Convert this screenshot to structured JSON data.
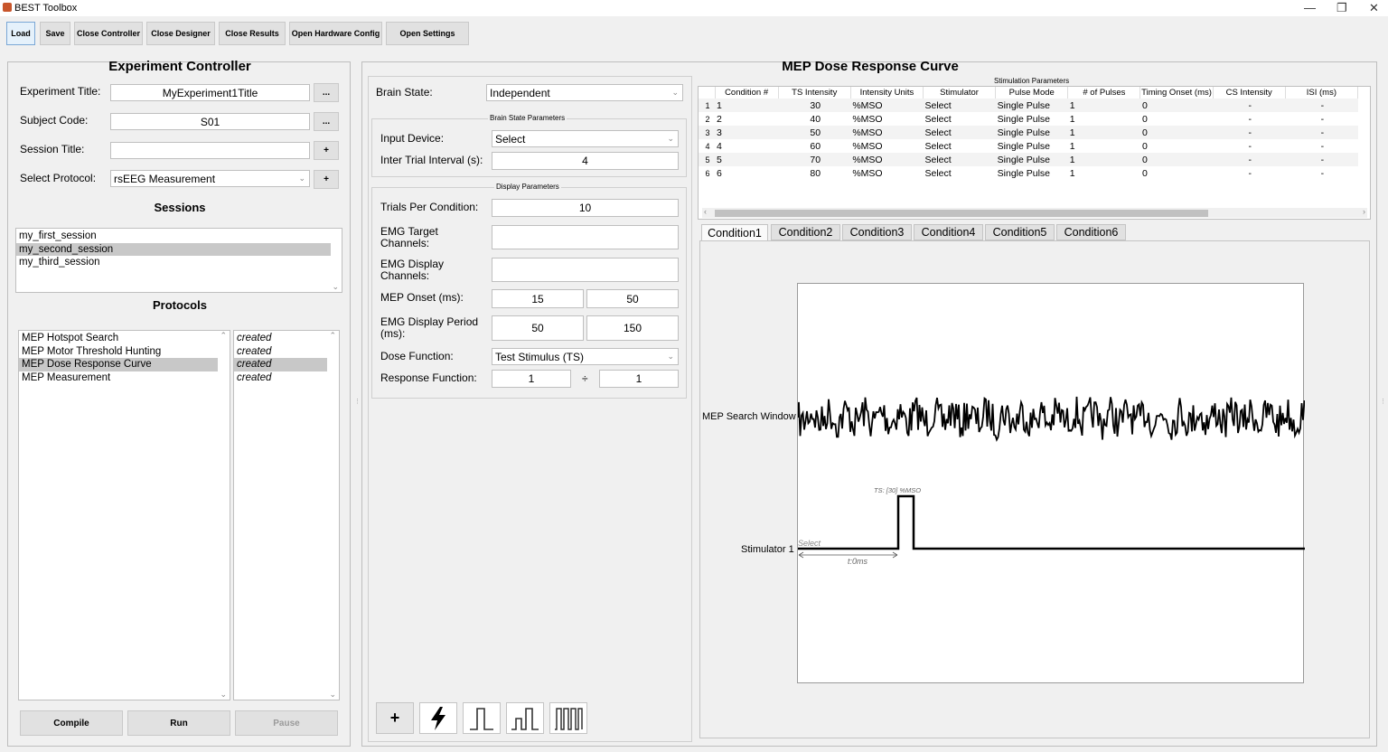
{
  "window": {
    "title": "BEST Toolbox"
  },
  "toolbar": {
    "buttons": [
      "Load",
      "Save",
      "Close Controller",
      "Close Designer",
      "Close Results",
      "Open Hardware Config",
      "Open Settings"
    ]
  },
  "controller": {
    "title": "Experiment Controller",
    "experiment_title_label": "Experiment Title:",
    "experiment_title_value": "MyExperiment1Title",
    "subject_code_label": "Subject Code:",
    "subject_code_value": "S01",
    "session_title_label": "Session Title:",
    "session_title_value": "",
    "select_protocol_label": "Select Protocol:",
    "select_protocol_value": "rsEEG Measurement",
    "browse_label": "...",
    "add_label": "+",
    "sessions_heading": "Sessions",
    "sessions": [
      "my_first_session",
      "my_second_session",
      "my_third_session"
    ],
    "protocols_heading": "Protocols",
    "protocols": [
      "MEP Hotspot Search",
      "MEP Motor Threshold Hunting",
      "MEP Dose Response Curve",
      "MEP Measurement"
    ],
    "protocol_status": [
      "created",
      "created",
      "created",
      "created"
    ],
    "compile_label": "Compile",
    "run_label": "Run",
    "pause_label": "Pause"
  },
  "designer": {
    "title": "MEP Dose Response Curve",
    "brain_state_label": "Brain State:",
    "brain_state_value": "Independent",
    "brain_state_params_title": "Brain State Parameters",
    "input_device_label": "Input Device:",
    "input_device_value": "Select",
    "iti_label": "Inter Trial Interval (s):",
    "iti_value": "4",
    "display_params_title": "Display Parameters",
    "trials_label": "Trials Per Condition:",
    "trials_value": "10",
    "emg_target_label": "EMG Target Channels:",
    "emg_target_value": "",
    "emg_display_label": "EMG Display Channels:",
    "emg_display_value": "",
    "mep_onset_label": "MEP Onset (ms):",
    "mep_onset_from": "15",
    "mep_onset_to": "50",
    "emg_period_label": "EMG Display Period (ms):",
    "emg_period_from": "50",
    "emg_period_to": "150",
    "dose_label": "Dose Function:",
    "dose_value": "Test Stimulus (TS)",
    "response_label": "Response Function:",
    "response_num": "1",
    "response_div": "÷",
    "response_den": "1",
    "bottom_icons": [
      "plus-icon",
      "lightning-icon",
      "single-pulse-icon",
      "paired-pulse-icon",
      "train-pulse-icon"
    ],
    "bottom_plus": "+"
  },
  "stim_table": {
    "title": "Stimulation Parameters",
    "columns": [
      "Condition #",
      "TS Intensity",
      "Intensity Units",
      "Stimulator",
      "Pulse Mode",
      "# of Pulses",
      "Timing Onset (ms)",
      "CS Intensity",
      "ISI (ms)"
    ],
    "rows": [
      [
        "1",
        "1",
        "30",
        "%MSO",
        "Select",
        "Single Pulse",
        "1",
        "0",
        "-",
        "-"
      ],
      [
        "2",
        "2",
        "40",
        "%MSO",
        "Select",
        "Single Pulse",
        "1",
        "0",
        "-",
        "-"
      ],
      [
        "3",
        "3",
        "50",
        "%MSO",
        "Select",
        "Single Pulse",
        "1",
        "0",
        "-",
        "-"
      ],
      [
        "4",
        "4",
        "60",
        "%MSO",
        "Select",
        "Single Pulse",
        "1",
        "0",
        "-",
        "-"
      ],
      [
        "5",
        "5",
        "70",
        "%MSO",
        "Select",
        "Single Pulse",
        "1",
        "0",
        "-",
        "-"
      ],
      [
        "6",
        "6",
        "80",
        "%MSO",
        "Select",
        "Single Pulse",
        "1",
        "0",
        "-",
        "-"
      ]
    ]
  },
  "tabs": [
    "Condition1",
    "Condition2",
    "Condition3",
    "Condition4",
    "Condition5",
    "Condition6"
  ],
  "plot": {
    "mep_label": "MEP Search Window",
    "stim_label": "Stimulator 1",
    "pulse_label": "TS: [30] %MSO",
    "select_label": "Select",
    "time_label": "t:0ms"
  }
}
